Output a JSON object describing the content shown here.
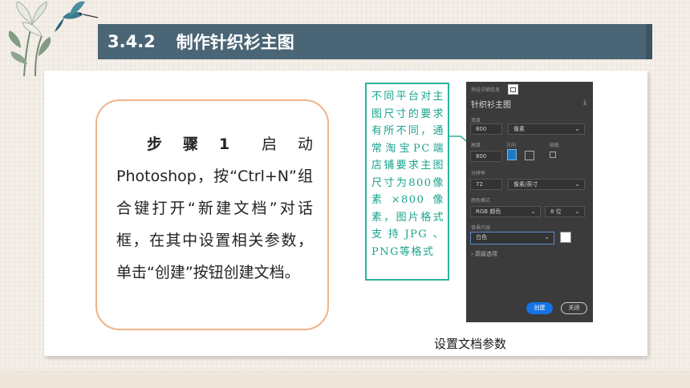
{
  "header": {
    "section_number": "3.4.2",
    "title": "制作针织衫主图"
  },
  "step_box": {
    "step_label": "步骤1",
    "text": "启动 Photoshop，按“Ctrl+N”组合键打开“新建文档”对话框，在其中设置相关参数，单击“创建”按钮创建文档。"
  },
  "note": {
    "text": "不同平台对主图尺寸的要求有所不同，通常淘宝PC端店铺要求主图尺寸为800像素×800像素，图片格式支持JPG、PNG等格式"
  },
  "dialog": {
    "preset_details_label": "预设详细信息",
    "doc_name": "针织衫主图",
    "width_label": "宽度",
    "width_value": "800",
    "width_unit": "像素",
    "height_label": "高度",
    "height_value": "800",
    "orientation_label": "方向",
    "artboard_label": "画板",
    "resolution_label": "分辨率",
    "resolution_value": "72",
    "resolution_unit": "像素/英寸",
    "color_mode_label": "颜色模式",
    "color_mode_value": "RGB 颜色",
    "bit_depth_value": "8 位",
    "background_label": "背景内容",
    "background_value": "白色",
    "background_swatch_color": "#ffffff",
    "advanced_label": "高级选项",
    "create_button": "创建",
    "close_button": "关闭"
  },
  "caption": "设置文档参数",
  "colors": {
    "title_bar": "#4a6676",
    "step_border": "#efb388",
    "note_accent": "#2bb29b",
    "create_button": "#1473e6"
  }
}
